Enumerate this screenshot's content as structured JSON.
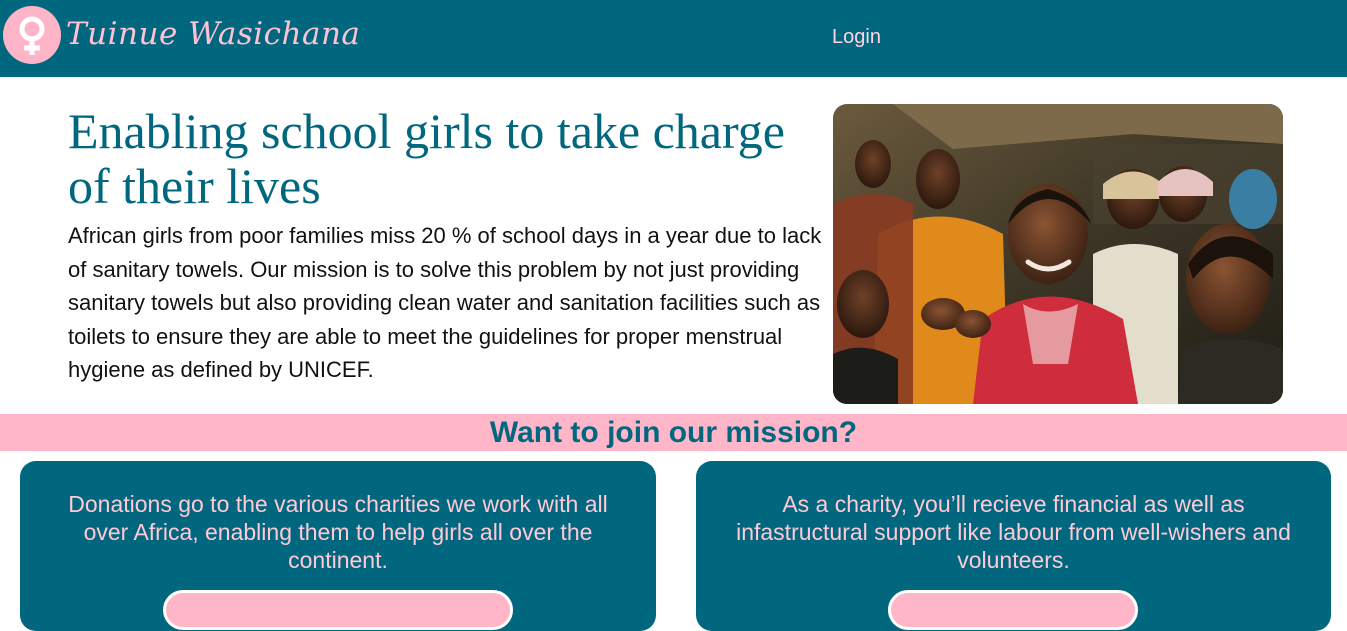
{
  "header": {
    "brand_name": "Tuinue Wasichana",
    "logo_icon": "female-symbol-icon",
    "nav": {
      "login_label": "Login"
    },
    "colors": {
      "background": "#00677f",
      "logo_circle": "#ffb5c8",
      "brand_text": "#ffc2d2"
    }
  },
  "hero": {
    "title": "Enabling school girls to take charge of their lives",
    "text": "African girls from poor families miss 20 % of school days in a year due to lack of sanitary towels. Our mission is to solve this problem by not just providing sanitary towels but also providing clean water and sanitation facilities such as toilets to ensure they are able to meet the guidelines for proper menstrual hygiene as defined by UNICEF.",
    "image_icon": "smiling-girls-photo"
  },
  "join": {
    "heading": "Want to join our mission?",
    "band_color": "#ffb6c9"
  },
  "cards": {
    "donor": {
      "text": "Donations go to the various charities we work with all over Africa, enabling them to help girls all over the continent."
    },
    "charity": {
      "text": "As a charity, you’ll recieve financial as well as infastructural support like labour from well-wishers and volunteers."
    }
  }
}
